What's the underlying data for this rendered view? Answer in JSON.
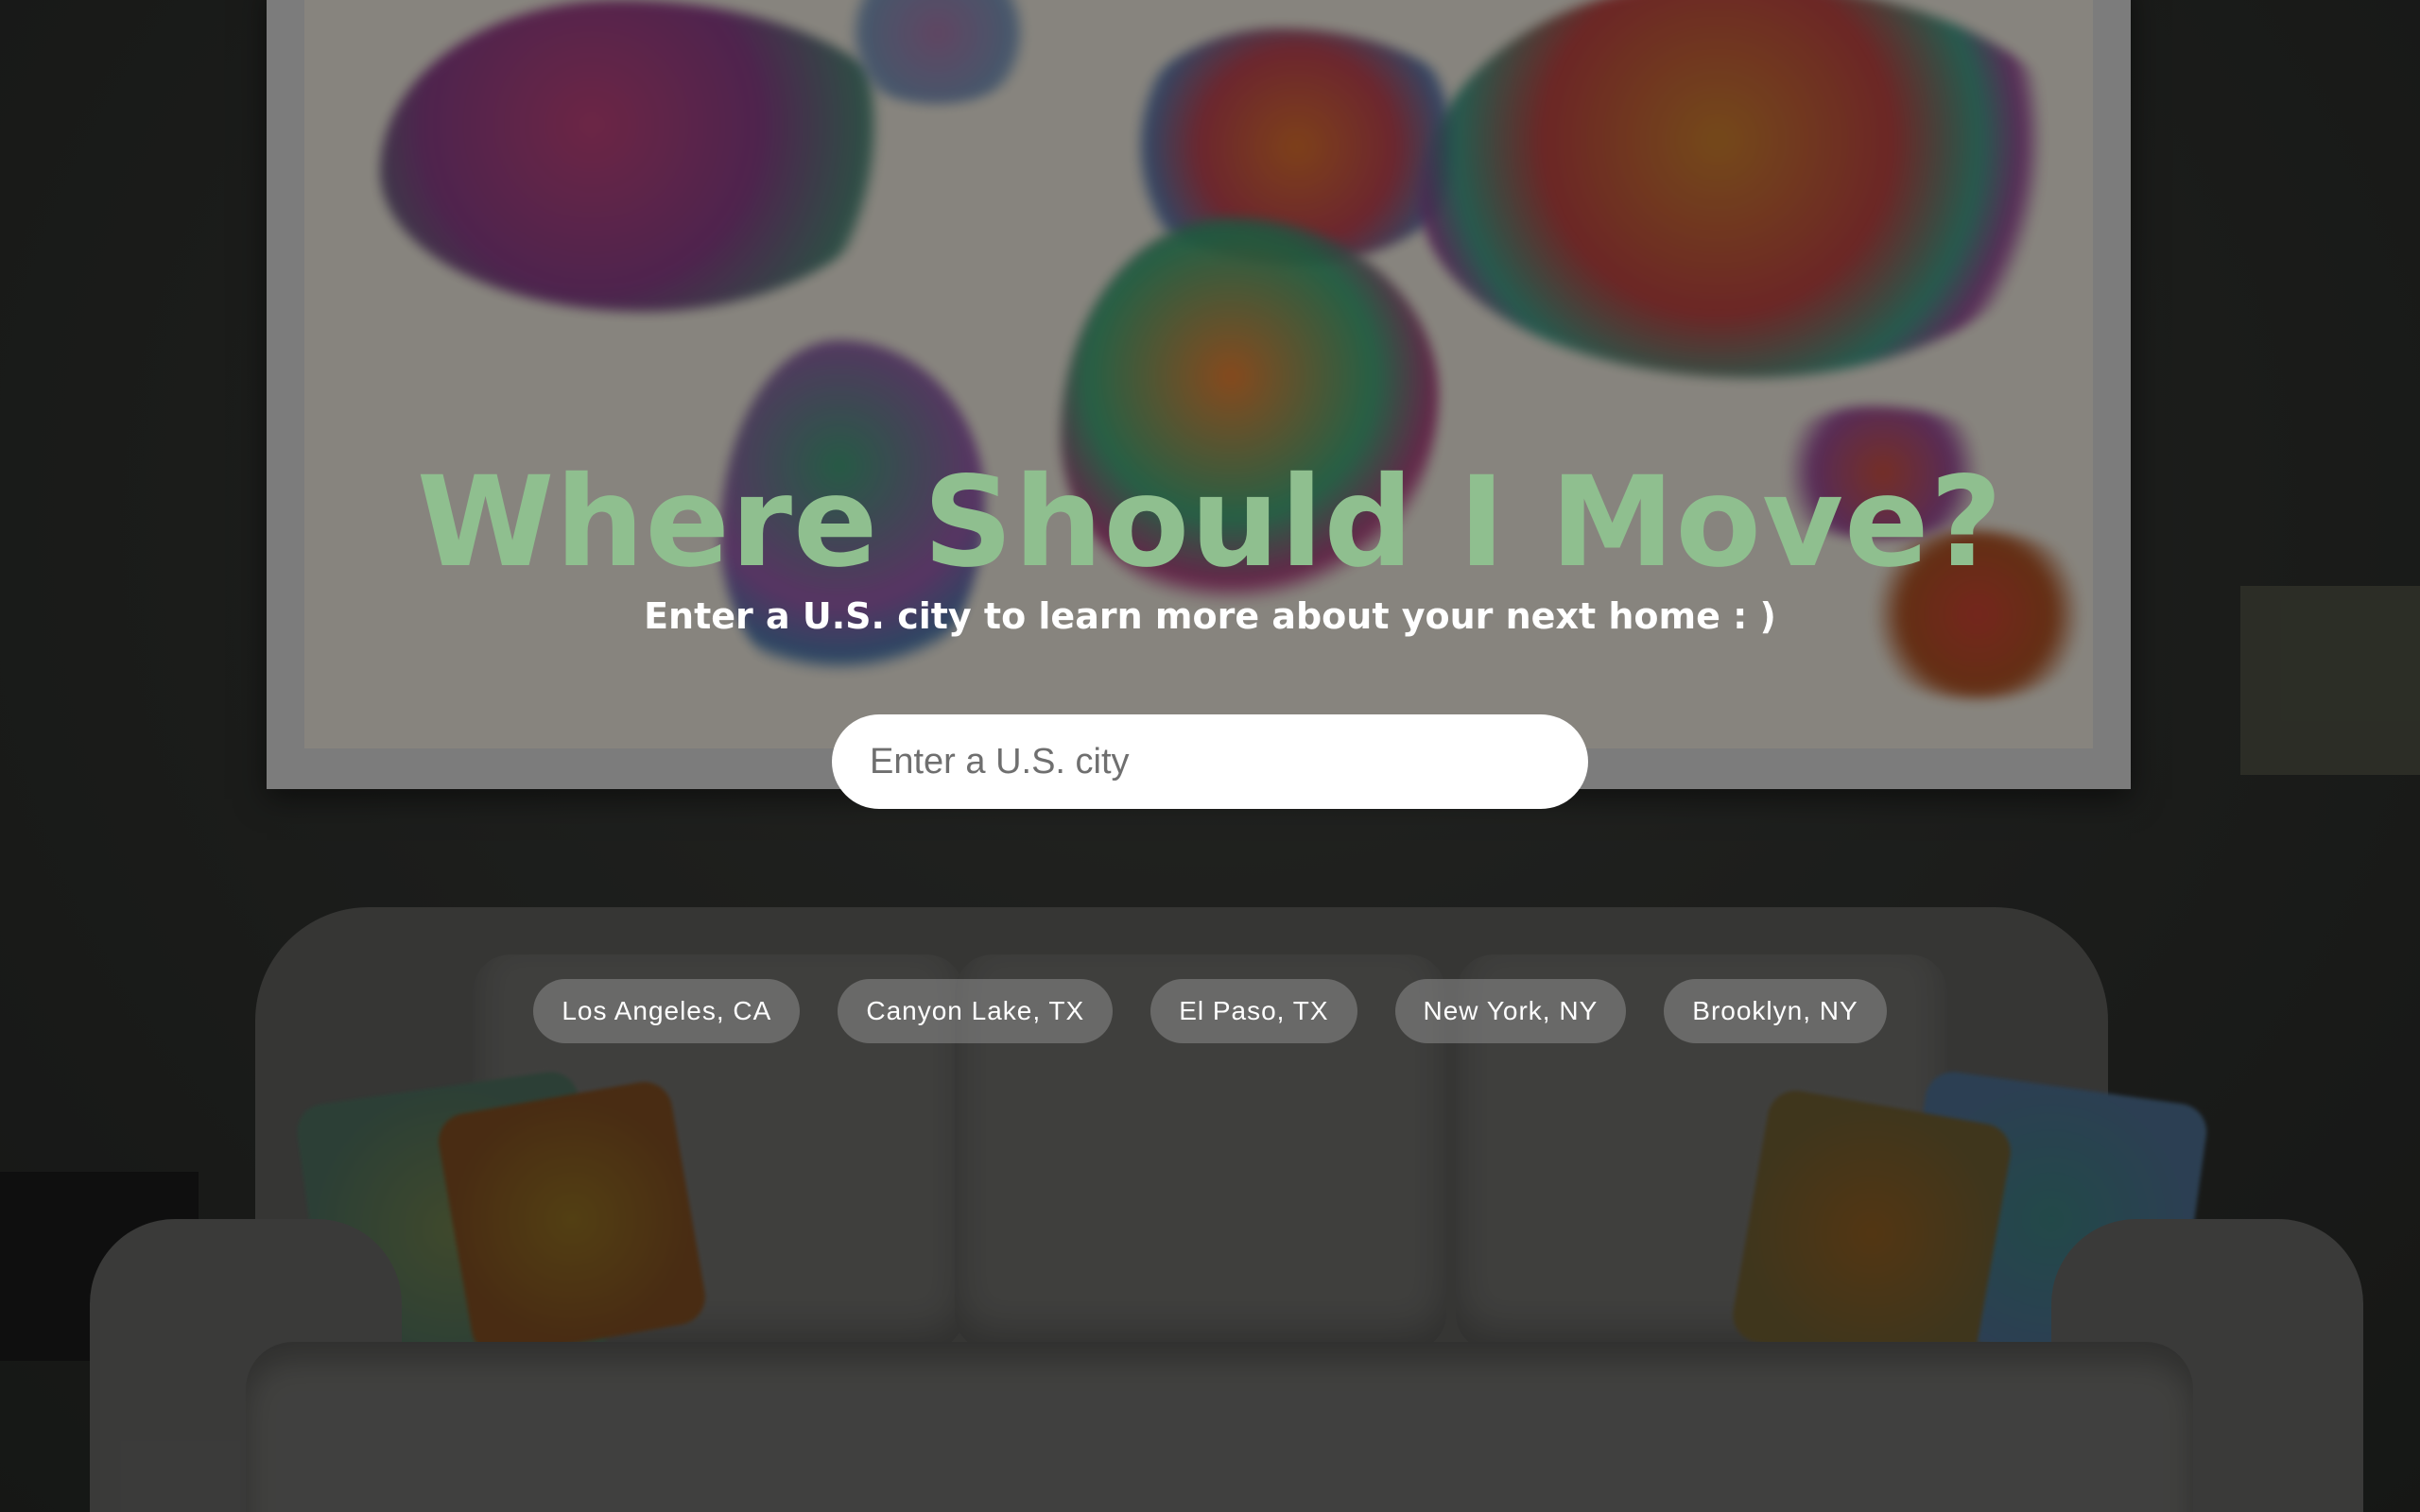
{
  "hero": {
    "title": "Where Should I Move?",
    "subtitle": "Enter a U.S. city to learn more about your next home : )"
  },
  "search": {
    "placeholder": "Enter a U.S. city",
    "value": ""
  },
  "suggestions": [
    "Los Angeles, CA",
    "Canyon Lake, TX",
    "El Paso, TX",
    "New York, NY",
    "Brooklyn, NY"
  ],
  "colors": {
    "title": "#8fbf8f",
    "subtitle": "#ffffff",
    "search_bg": "#ffffff",
    "chip_bg": "#8c8c8c"
  }
}
